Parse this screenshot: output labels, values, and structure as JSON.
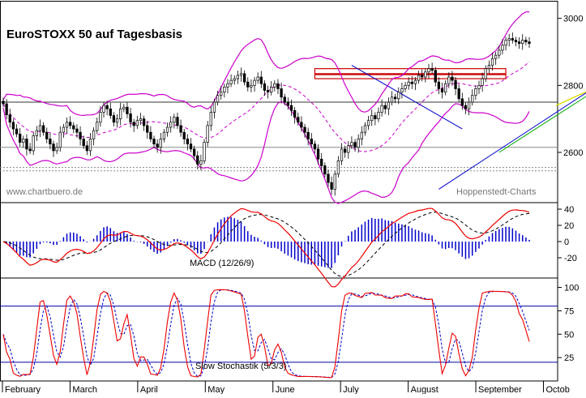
{
  "chart_data": [
    {
      "type": "candlestick",
      "title": "EuroSTOXX 50 auf Tagesbasis",
      "watermark_left": "www.chartbuero.de",
      "watermark_right": "Hoppenstedt-Charts",
      "y_ticks": [
        2600,
        2800,
        3000
      ],
      "ylim": [
        2450,
        3050
      ],
      "x_months": [
        "February",
        "March",
        "April",
        "May",
        "June",
        "July",
        "August",
        "September",
        "Octob"
      ],
      "closes": [
        2745,
        2712,
        2690,
        2670,
        2655,
        2630,
        2640,
        2610,
        2605,
        2650,
        2665,
        2680,
        2660,
        2640,
        2625,
        2605,
        2615,
        2660,
        2675,
        2690,
        2680,
        2670,
        2660,
        2640,
        2620,
        2605,
        2640,
        2665,
        2690,
        2720,
        2740,
        2730,
        2710,
        2690,
        2700,
        2730,
        2735,
        2715,
        2690,
        2680,
        2695,
        2700,
        2680,
        2660,
        2640,
        2625,
        2615,
        2640,
        2660,
        2675,
        2690,
        2705,
        2680,
        2660,
        2640,
        2625,
        2610,
        2590,
        2565,
        2575,
        2630,
        2680,
        2720,
        2750,
        2770,
        2780,
        2795,
        2805,
        2815,
        2820,
        2830,
        2835,
        2810,
        2795,
        2800,
        2815,
        2825,
        2805,
        2785,
        2780,
        2795,
        2805,
        2790,
        2765,
        2750,
        2740,
        2725,
        2705,
        2690,
        2675,
        2660,
        2640,
        2625,
        2610,
        2580,
        2560,
        2535,
        2510,
        2490,
        2535,
        2575,
        2610,
        2600,
        2620,
        2630,
        2615,
        2640,
        2660,
        2680,
        2695,
        2710,
        2700,
        2720,
        2740,
        2730,
        2750,
        2765,
        2760,
        2780,
        2790,
        2800,
        2810,
        2805,
        2815,
        2830,
        2825,
        2840,
        2850,
        2845,
        2810,
        2790,
        2780,
        2805,
        2825,
        2815,
        2790,
        2760,
        2740,
        2730,
        2750,
        2770,
        2790,
        2800,
        2820,
        2850,
        2860,
        2880,
        2890,
        2905,
        2920,
        2935,
        2940,
        2935,
        2930,
        2925,
        2935,
        2930,
        2925
      ],
      "series": [
        {
          "name": "Bollinger-Band",
          "color": "#cc00cc"
        },
        {
          "name": "GD",
          "color": "#cc00cc"
        }
      ],
      "horizontal_lines": [
        2750,
        2615,
        2555,
        2545
      ],
      "resistance_zones": [
        [
          2835,
          2850
        ],
        [
          2820,
          2832
        ]
      ]
    },
    {
      "type": "line",
      "title": "MACD (12/26/9)",
      "y_ticks": [
        40,
        20,
        0,
        -20
      ],
      "ylim": [
        -45,
        48
      ],
      "series": [
        {
          "name": "MACD",
          "color": "#ee0000"
        },
        {
          "name": "Signal",
          "color": "#000000"
        },
        {
          "name": "Histogramm",
          "color": "#0000cc"
        }
      ]
    },
    {
      "type": "line",
      "title": "Slow Stochastik (5/3/3)",
      "y_ticks": [
        100,
        75,
        50,
        25
      ],
      "ylim": [
        0,
        110
      ],
      "levels": [
        80,
        20
      ],
      "series": [
        {
          "name": "%K",
          "color": "#ee0000"
        },
        {
          "name": "%D",
          "color": "#0000cc"
        }
      ]
    }
  ]
}
